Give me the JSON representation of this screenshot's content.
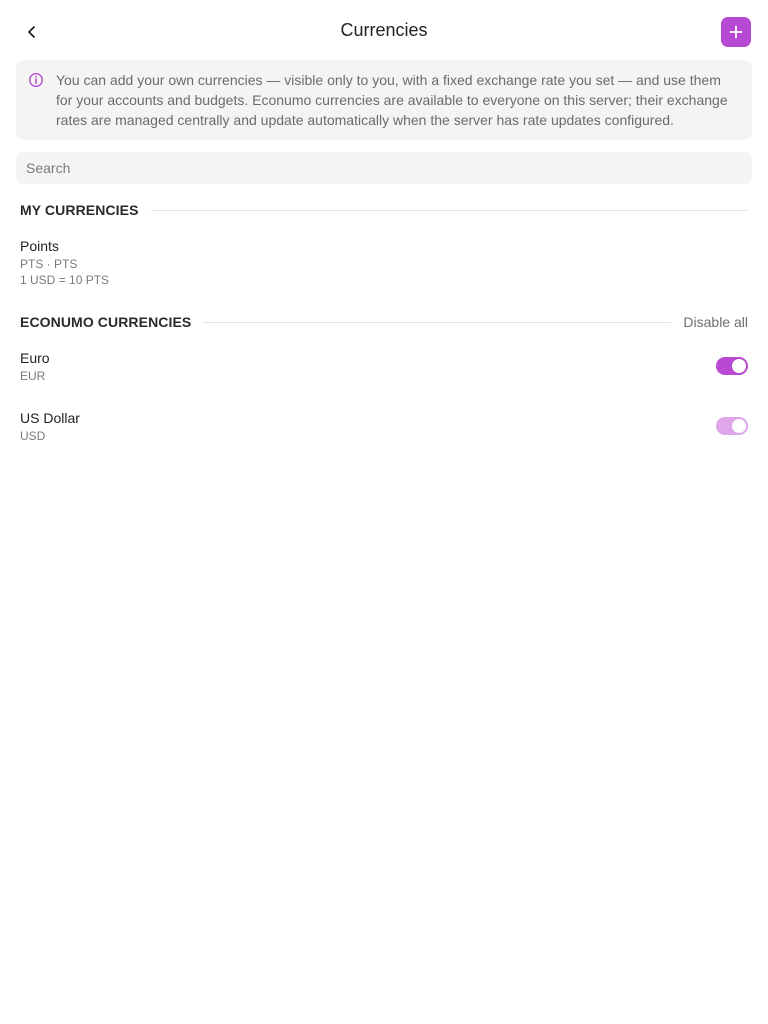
{
  "header": {
    "title": "Currencies",
    "back_icon": "chevron-left-icon",
    "add_icon": "plus-icon"
  },
  "info": {
    "icon": "info-circle-icon",
    "text": "You can add your own currencies — visible only to you, with a fixed exchange rate you set — and use them for your accounts and budgets. Econumo currencies are available to everyone on this server; their exchange rates are managed centrally and update automatically when the server has rate updates configured."
  },
  "search": {
    "placeholder": "Search",
    "value": ""
  },
  "my_currencies": {
    "title": "MY CURRENCIES",
    "items": [
      {
        "name": "Points",
        "codes": "PTS · PTS",
        "rate": "1 USD = 10 PTS"
      }
    ]
  },
  "econumo_currencies": {
    "title": "ECONUMO CURRENCIES",
    "action": "Disable all",
    "items": [
      {
        "name": "Euro",
        "code": "EUR",
        "enabled": true,
        "locked": false
      },
      {
        "name": "US Dollar",
        "code": "USD",
        "enabled": true,
        "locked": true
      }
    ]
  },
  "colors": {
    "accent": "#b849d2",
    "accent_disabled": "#dfa6ea",
    "panel_bg": "#f4f4f5"
  }
}
